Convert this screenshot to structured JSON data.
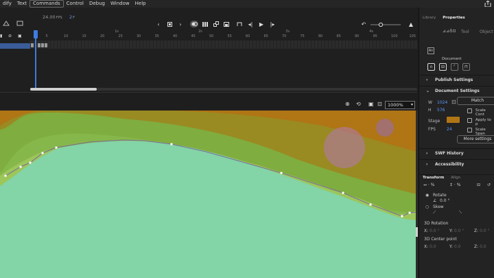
{
  "menu": {
    "items": [
      "dify",
      "Text",
      "Commands",
      "Control",
      "Debug",
      "Window",
      "Help"
    ],
    "active": "Commands"
  },
  "timeline": {
    "fps_value": "24.00",
    "fps_unit": "FPS",
    "frame_value": "2",
    "frame_unit": "F",
    "ruler_labels": [
      {
        "n": "1s",
        "f": 12
      },
      {
        "n": "5",
        "f": 5
      },
      {
        "n": "10",
        "f": 10
      },
      {
        "n": "15",
        "f": 15
      },
      {
        "n": "20",
        "f": 20
      },
      {
        "n": "25",
        "f": 25
      },
      {
        "n": "30",
        "f": 30
      },
      {
        "n": "35",
        "f": 35
      },
      {
        "n": "40",
        "f": 40
      },
      {
        "n": "45",
        "f": 45
      },
      {
        "n": "50",
        "f": 50
      },
      {
        "n": "55",
        "f": 55
      },
      {
        "n": "60",
        "f": 60
      },
      {
        "n": "65",
        "f": 65
      },
      {
        "n": "70",
        "f": 70
      },
      {
        "n": "75",
        "f": 75
      },
      {
        "n": "80",
        "f": 80
      },
      {
        "n": "85",
        "f": 85
      },
      {
        "n": "90",
        "f": 90
      },
      {
        "n": "95",
        "f": 95
      },
      {
        "n": "100",
        "f": 100
      },
      {
        "n": "105",
        "f": 105
      }
    ],
    "second_marks": [
      {
        "n": "2s",
        "f": 47
      },
      {
        "n": "3s",
        "f": 71
      },
      {
        "n": "4s",
        "f": 94
      }
    ]
  },
  "canvas": {
    "zoom": "1000%"
  },
  "panel": {
    "tabs": [
      "Library",
      "Properties"
    ],
    "active_tab": "Properties",
    "subtabs": [
      "Tool",
      "Object"
    ],
    "doc_label": "Document",
    "publish_settings": "Publish Settings",
    "document_settings": "Document Settings",
    "w_label": "W",
    "w_value": "1024",
    "h_label": "H",
    "h_value": "576",
    "match_label": "Match",
    "scale_content": "Scale Cont",
    "apply_to": "Apply to p",
    "scale_spans": "Scale Span",
    "stage_label": "Stage",
    "stage_color": "#b07515",
    "fps_label": "FPS",
    "fps_value": "24",
    "more_settings": "More settings",
    "swf_history": "SWF History",
    "accessibility": "Accessibility",
    "transform_tabs": [
      "Transform",
      "Align"
    ],
    "rotate_label": "Rotate",
    "rotate_value": "0.0 °",
    "skew_label": "Skew",
    "rotation_3d": "3D Rotation",
    "center_3d": "3D Center point",
    "x_label": "X:",
    "y_label": "Y:",
    "z_label": "Z:",
    "zero": "0.0 °",
    "zero_plain": "0.0",
    "pct": "%"
  },
  "colors": {
    "accent": "#3f7be0",
    "stage_bg": "#b07515",
    "hill_dark": "#7fad3f",
    "hill_mid": "#9cc65a",
    "ground": "#83d4a6",
    "circle": "#b07aa8"
  }
}
